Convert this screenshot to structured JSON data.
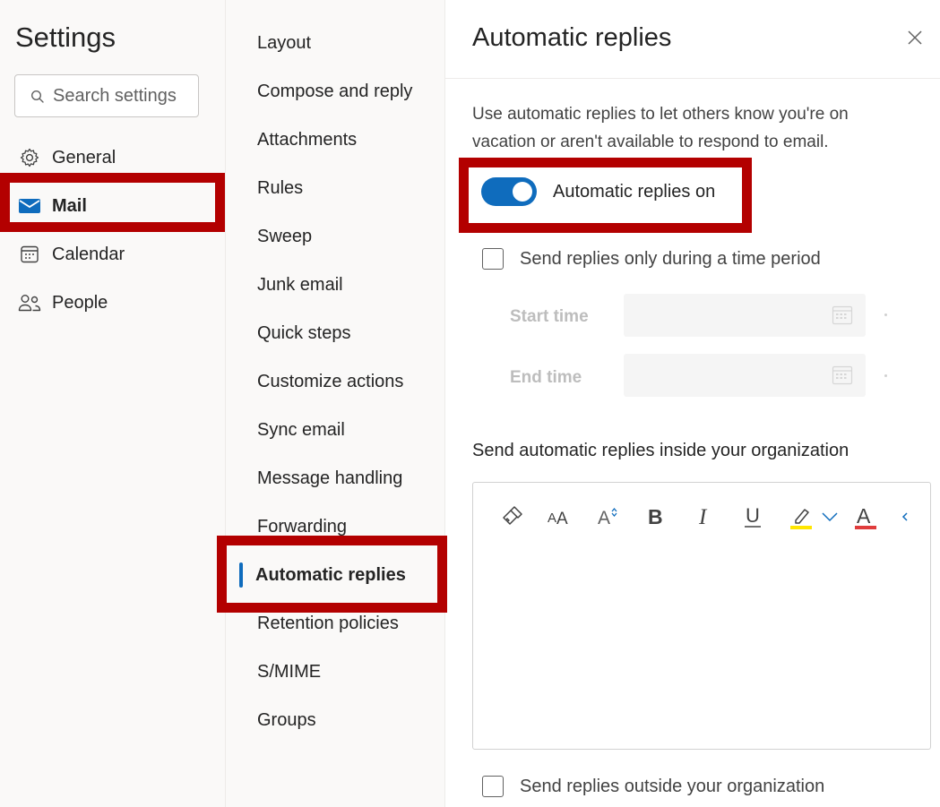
{
  "left_nav": {
    "title": "Settings",
    "search_placeholder": "Search settings",
    "items": [
      {
        "label": "General",
        "icon": "gear-icon"
      },
      {
        "label": "Mail",
        "icon": "mail-icon",
        "selected": true
      },
      {
        "label": "Calendar",
        "icon": "calendar-icon"
      },
      {
        "label": "People",
        "icon": "people-icon"
      }
    ]
  },
  "mail_nav": {
    "items": [
      "Layout",
      "Compose and reply",
      "Attachments",
      "Rules",
      "Sweep",
      "Junk email",
      "Quick steps",
      "Customize actions",
      "Sync email",
      "Message handling",
      "Forwarding",
      "Automatic replies",
      "Retention policies",
      "S/MIME",
      "Groups"
    ],
    "selected": "Automatic replies"
  },
  "panel": {
    "title": "Automatic replies",
    "description": "Use automatic replies to let others know you're on vacation or aren't available to respond to email.",
    "toggle_label": "Automatic replies on",
    "toggle_on": true,
    "time_period_label": "Send replies only during a time period",
    "start_time_label": "Start time",
    "end_time_label": "End time",
    "inside_org_label": "Send automatic replies inside your organization",
    "outside_org_label": "Send replies outside your organization"
  },
  "toolbar": {
    "buttons": [
      "format-painter-icon",
      "font-size-icon",
      "grow-font-icon",
      "bold-icon",
      "italic-icon",
      "underline-icon",
      "highlight-icon",
      "chevron-down-icon",
      "font-color-icon",
      "more-icon"
    ]
  },
  "colors": {
    "accent": "#0f6cbd",
    "annotation": "#b30000",
    "highlight": "#ffe600",
    "font_color": "#e03c3c"
  }
}
